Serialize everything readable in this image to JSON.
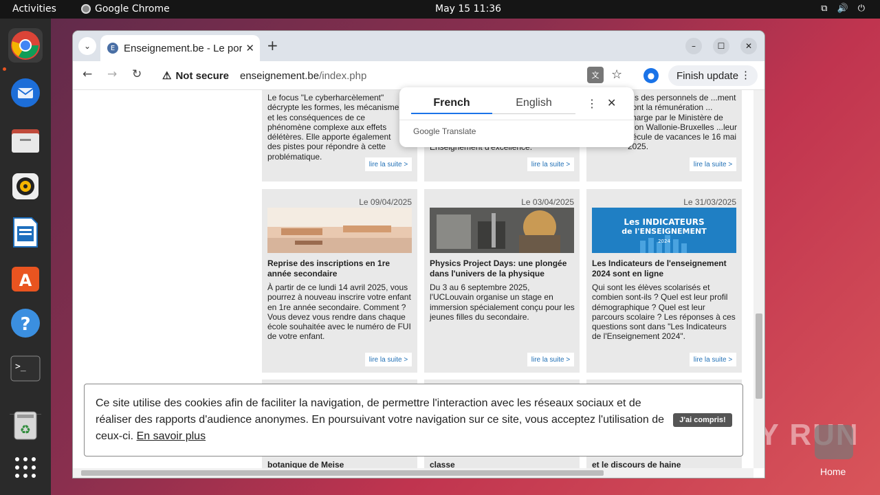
{
  "topbar": {
    "activities": "Activities",
    "app_name": "Google Chrome",
    "clock": "May 15  11:36"
  },
  "dock": {
    "items": [
      "chrome-icon",
      "thunderbird-icon",
      "files-icon",
      "rhythmbox-icon",
      "writer-icon",
      "app-center-icon",
      "help-icon",
      "terminal-icon",
      "trash-icon",
      "app-grid-icon"
    ]
  },
  "browser": {
    "tab_title": "Enseignement.be - Le portail",
    "new_tab": "+",
    "security_label": "Not secure",
    "url_host": "enseignement.be",
    "url_path": "/index.php",
    "finish_update": "Finish update"
  },
  "translate_popup": {
    "source_lang": "French",
    "target_lang": "English",
    "brand": "Google Translate"
  },
  "top_cards": [
    {
      "body": "Le focus \"Le cyberharcèlement\" décrypte les formes, les mécanismes et les conséquences de ce phénomène complexe aux effets délétères. Elle apporte également des pistes pour répondre à cette problématique.",
      "more": "lire la suite >"
    },
    {
      "body": "Enseignement d'excellence.",
      "more": "lire la suite >"
    },
    {
      "body": "...s des personnels de ...ment dont la rémunération ... charge par le Ministère de ...on Wallonie-Bruxelles ...leur pécule de vacances le 16 mai 2025.",
      "more": "lire la suite >"
    }
  ],
  "cards": [
    {
      "date": "Le 09/04/2025",
      "title": "Reprise des inscriptions en 1re année secondaire",
      "body": "À partir de ce lundi 14 avril 2025, vous pourrez à nouveau inscrire votre enfant en 1re année secondaire. Comment ? Vous devez vous rendre dans chaque école souhaitée avec le numéro de FUI de votre enfant.",
      "more": "lire la suite >"
    },
    {
      "date": "Le 03/04/2025",
      "title": "Physics Project Days: une plongée dans l'univers de la physique",
      "body": "Du 3 au 6 septembre 2025, l'UCLouvain organise un stage en immersion spécialement conçu pour les jeunes filles du secondaire.",
      "more": "lire la suite >"
    },
    {
      "date": "Le 31/03/2025",
      "title": "Les Indicateurs de l'enseignement 2024 sont en ligne",
      "body": "Qui sont les élèves scolarisés et combien sont-ils ? Quel est leur profil démographique ? Quel est leur parcours scolaire ? Les réponses à ces questions sont dans \"Les Indicateurs de l'Enseignement 2024\".",
      "more": "lire la suite >",
      "image_text": "Les INDICATEURS de l'ENSEIGNEMENT 2024"
    }
  ],
  "peek_cards": [
    "botanique de Meise",
    "classe",
    "et le discours de haine"
  ],
  "cookie": {
    "text": "Ce site utilise des cookies afin de faciliter la navigation, de permettre l'interaction avec les réseaux sociaux et de réaliser des rapports d'audience anonymes. En poursuivant votre navigation sur ce site, vous acceptez l'utilisation de ceux-ci.",
    "link": "En savoir plus",
    "button": "J'ai compris!"
  },
  "desktop": {
    "home_label": "Home",
    "watermark": "ANY RUN"
  }
}
